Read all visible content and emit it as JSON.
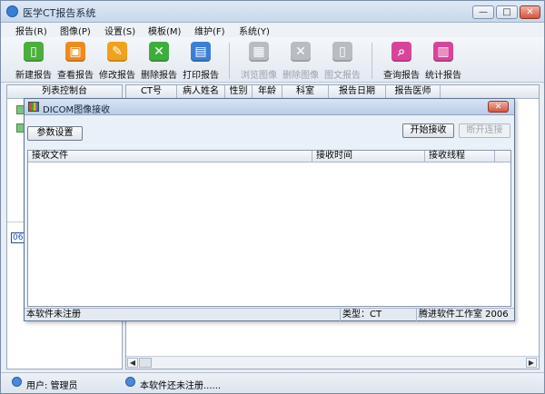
{
  "window": {
    "title": "医学CT报告系统",
    "min": "—",
    "max": "□",
    "close": "✕"
  },
  "menu": [
    "报告(R)",
    "图像(P)",
    "设置(S)",
    "模板(M)",
    "维护(F)",
    "系统(Y)"
  ],
  "toolbar": [
    {
      "label": "新建报告",
      "icon": "new-report-icon",
      "color": "#4caf3c",
      "glyph": "▯",
      "enabled": true
    },
    {
      "label": "查看报告",
      "icon": "view-report-icon",
      "color": "#f08a1c",
      "glyph": "▣",
      "enabled": true
    },
    {
      "label": "修改报告",
      "icon": "edit-report-icon",
      "color": "#f0a21c",
      "glyph": "✎",
      "enabled": true
    },
    {
      "label": "删除报告",
      "icon": "delete-report-icon",
      "color": "#3dad3d",
      "glyph": "✕",
      "enabled": true
    },
    {
      "label": "打印报告",
      "icon": "print-report-icon",
      "color": "#3a7fd6",
      "glyph": "▤",
      "enabled": true
    },
    {
      "label": "浏览图像",
      "icon": "browse-image-icon",
      "color": "#b8bdc4",
      "glyph": "▦",
      "enabled": false
    },
    {
      "label": "删除图像",
      "icon": "delete-image-icon",
      "color": "#b8bdc4",
      "glyph": "✕",
      "enabled": false
    },
    {
      "label": "图文报告",
      "icon": "image-text-report-icon",
      "color": "#b8bdc4",
      "glyph": "▯",
      "enabled": false
    },
    {
      "label": "查询报告",
      "icon": "search-report-icon",
      "color": "#d9449a",
      "glyph": "⌕",
      "enabled": true
    },
    {
      "label": "统计报告",
      "icon": "statistics-report-icon",
      "color": "#d9449a",
      "glyph": "▥",
      "enabled": true
    }
  ],
  "left_panel": {
    "header": "列表控制台",
    "marker": "06"
  },
  "grid": {
    "columns": [
      "CT号",
      "病人姓名",
      "性别",
      "年龄",
      "科室",
      "报告日期",
      "报告医师"
    ]
  },
  "status": {
    "user": "用户: 管理员",
    "message": "本软件还未注册......"
  },
  "dialog": {
    "title": "DICOM图像接收",
    "close": "✕",
    "params_button": "参数设置",
    "start_button": "开始接收",
    "disconnect_button": "断开连接",
    "columns": [
      "接收文件",
      "接收时间",
      "接收线程"
    ],
    "status": {
      "register": "本软件未注册",
      "type": "类型：CT",
      "studio": "腾进软件工作室 2006"
    }
  }
}
